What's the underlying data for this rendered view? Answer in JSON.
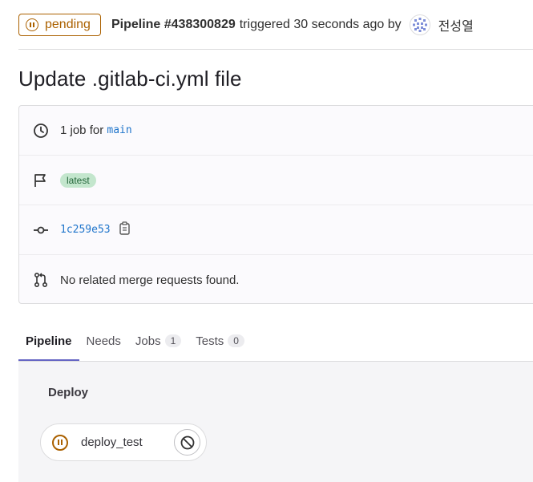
{
  "header": {
    "status_label": "pending",
    "pipeline_id": "Pipeline #438300829",
    "triggered_text": "triggered 30 seconds ago by",
    "author": "전성열"
  },
  "page": {
    "title": "Update .gitlab-ci.yml file"
  },
  "info": {
    "job_count_text": "1 job for",
    "branch": "main",
    "latest_badge": "latest",
    "commit_sha": "1c259e53",
    "merge_requests_text": "No related merge requests found."
  },
  "tabs": [
    {
      "label": "Pipeline",
      "active": true
    },
    {
      "label": "Needs"
    },
    {
      "label": "Jobs",
      "count": "1"
    },
    {
      "label": "Tests",
      "count": "0"
    }
  ],
  "stage": {
    "title": "Deploy",
    "job": {
      "name": "deploy_test",
      "status": "pending"
    }
  },
  "colors": {
    "pending": "#ab6100",
    "link": "#1f75cb",
    "tab_active": "#6666c4"
  }
}
